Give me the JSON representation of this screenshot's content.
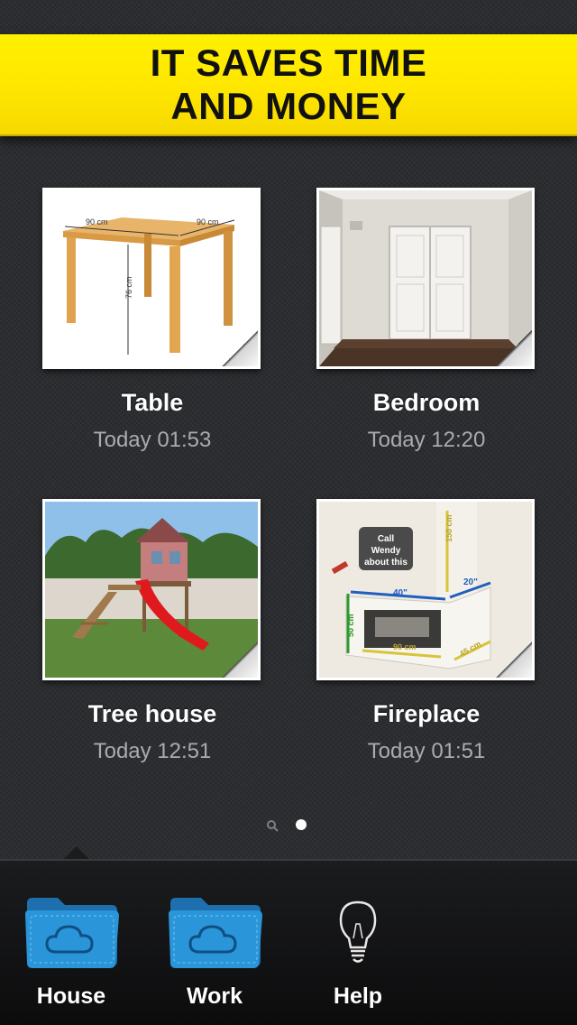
{
  "banner": {
    "line1": "IT SAVES TIME",
    "line2": "AND MONEY"
  },
  "projects": [
    {
      "title": "Table",
      "time": "Today 01:53",
      "thumbnail": "table-photo"
    },
    {
      "title": "Bedroom",
      "time": "Today 12:20",
      "thumbnail": "bedroom-photo"
    },
    {
      "title": "Tree house",
      "time": "Today 12:51",
      "thumbnail": "treehouse-photo"
    },
    {
      "title": "Fireplace",
      "time": "Today 01:51",
      "thumbnail": "fireplace-photo"
    }
  ],
  "table_dims": {
    "w": "90 cm",
    "d": "90 cm",
    "h": "76 cm"
  },
  "fireplace_note": {
    "line1": "Call",
    "line2": "Wendy",
    "line3": "about this"
  },
  "fireplace_dims": {
    "a": "40\"",
    "b": "20\"",
    "c": "50 cm",
    "d": "90 cm",
    "e": "150 cm",
    "f": "45 cm"
  },
  "pager": {
    "pages": 2,
    "active": 1
  },
  "tabs": [
    {
      "label": "House",
      "icon": "folder-cloud-icon"
    },
    {
      "label": "Work",
      "icon": "folder-cloud-icon"
    },
    {
      "label": "Help",
      "icon": "lightbulb-icon"
    }
  ],
  "colors": {
    "banner": "#ffe600",
    "background": "#2b2d30",
    "folder": "#2a8fd0"
  }
}
